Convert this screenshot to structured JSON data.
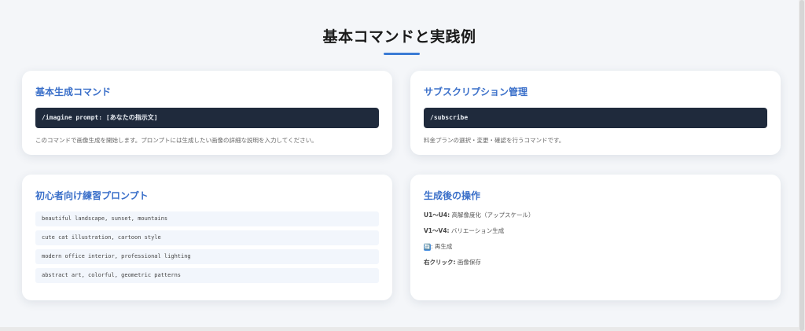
{
  "page": {
    "title": "基本コマンドと実践例"
  },
  "cards": {
    "basic": {
      "heading": "基本生成コマンド",
      "code": "/imagine prompt: [あなたの指示文]",
      "desc": "このコマンドで画像生成を開始します。プロンプトには生成したい画像の詳細な説明を入力してください。"
    },
    "subscription": {
      "heading": "サブスクリプション管理",
      "code": "/subscribe",
      "desc": "料金プランの選択・変更・確認を行うコマンドです。"
    },
    "practice": {
      "heading": "初心者向け練習プロンプト",
      "prompts": [
        "beautiful landscape, sunset, mountains",
        "cute cat illustration, cartoon style",
        "modern office interior, professional lighting",
        "abstract art, colorful, geometric patterns"
      ]
    },
    "after": {
      "heading": "生成後の操作",
      "ops": [
        {
          "key": "U1〜U4:",
          "text": " 高解像度化（アップスケール）"
        },
        {
          "key": "V1〜V4:",
          "text": " バリエーション生成"
        },
        {
          "key": "🔄",
          "text": ": 再生成"
        },
        {
          "key": "右クリック:",
          "text": " 画像保存"
        }
      ]
    }
  },
  "colors": {
    "accent": "#3a6fc9",
    "code_bg": "#1f2a3c"
  }
}
